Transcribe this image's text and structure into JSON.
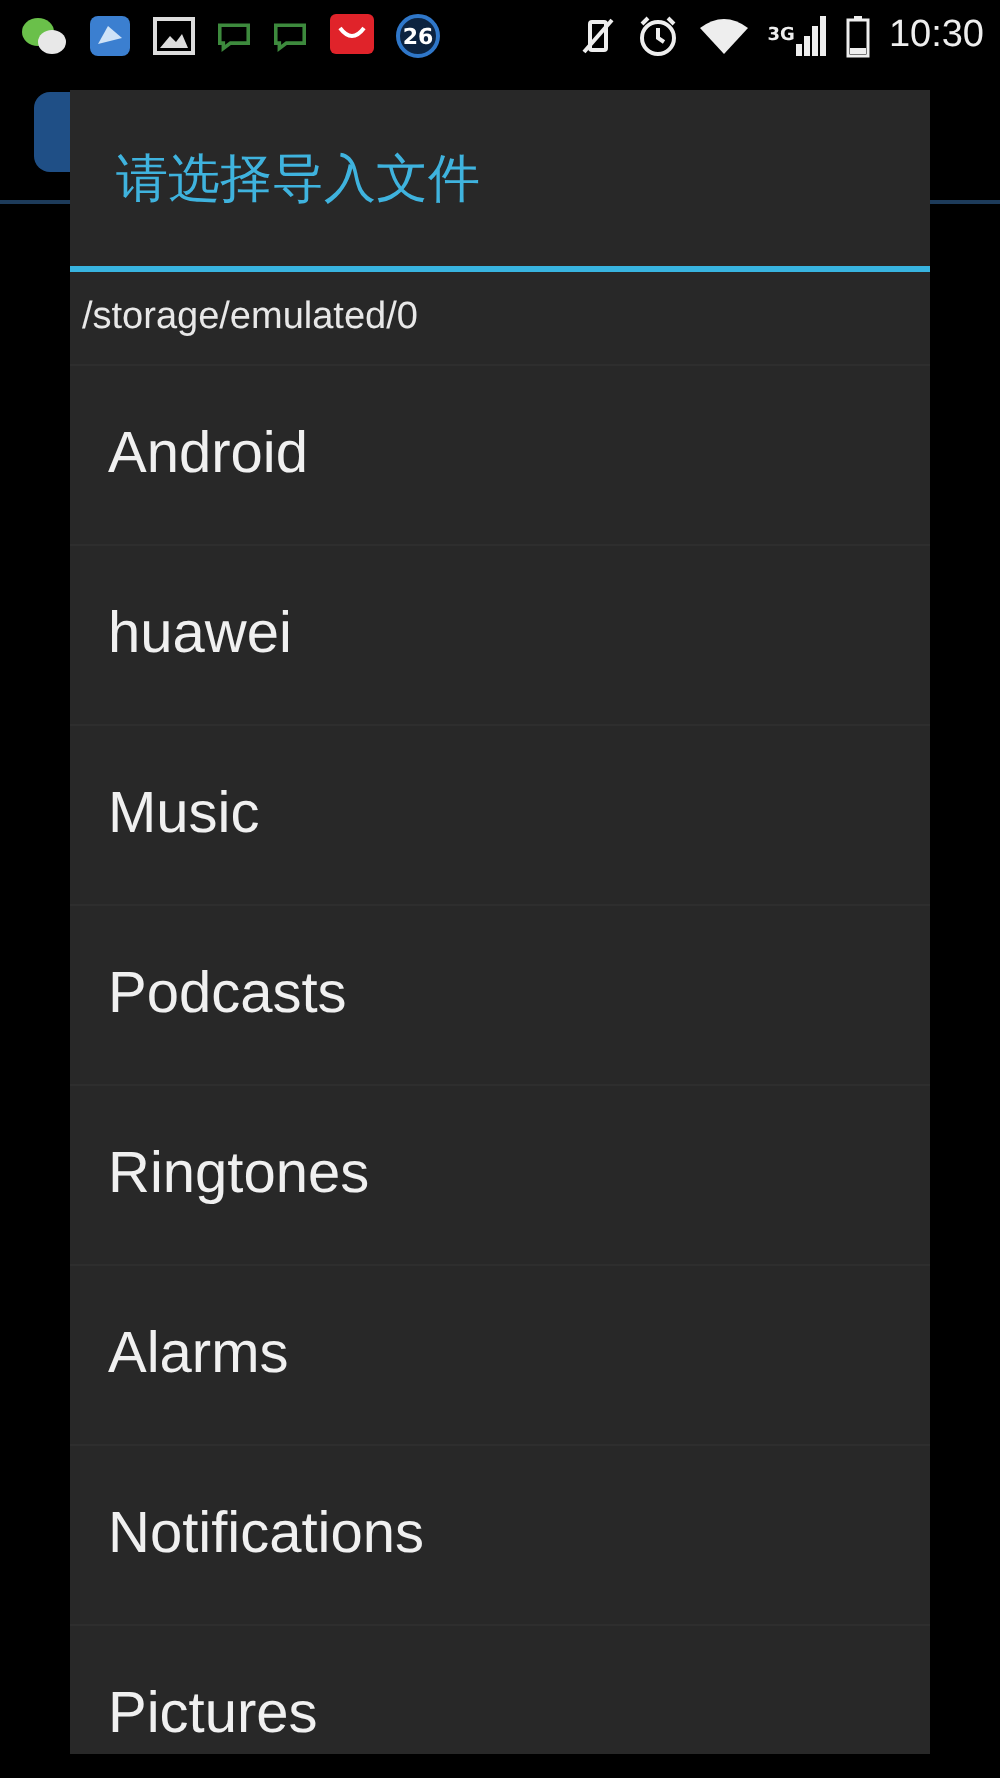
{
  "status_bar": {
    "notification_badge": "26",
    "network": "3G",
    "time": "10:30"
  },
  "dialog": {
    "title": "请选择导入文件",
    "path": "/storage/emulated/0",
    "items": [
      {
        "label": "Android"
      },
      {
        "label": "huawei"
      },
      {
        "label": "Music"
      },
      {
        "label": "Podcasts"
      },
      {
        "label": "Ringtones"
      },
      {
        "label": "Alarms"
      },
      {
        "label": "Notifications"
      },
      {
        "label": "Pictures"
      }
    ]
  }
}
